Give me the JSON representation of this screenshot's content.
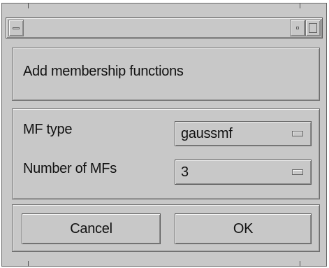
{
  "window": {
    "title_bar": ""
  },
  "dialog": {
    "heading": "Add membership functions",
    "fields": [
      {
        "label": "MF type",
        "value": "gaussmf"
      },
      {
        "label": "Number of MFs",
        "value": "3"
      }
    ],
    "buttons": {
      "cancel_label": "Cancel",
      "ok_label": "OK"
    }
  },
  "colors": {
    "background": "#c8c8c8",
    "border": "#6e6e6e",
    "text": "#111111"
  }
}
